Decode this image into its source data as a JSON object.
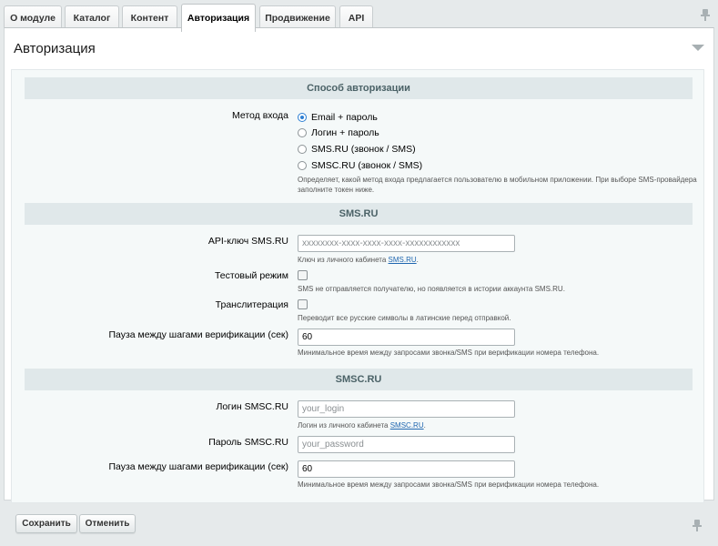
{
  "tabs": [
    {
      "label": "О модуле",
      "active": false
    },
    {
      "label": "Каталог",
      "active": false
    },
    {
      "label": "Контент",
      "active": false
    },
    {
      "label": "Авторизация",
      "active": true
    },
    {
      "label": "Продвижение",
      "active": false
    },
    {
      "label": "API",
      "active": false
    }
  ],
  "panel": {
    "title": "Авторизация"
  },
  "auth_section": {
    "title": "Способ авторизации",
    "method_label": "Метод входа",
    "options": [
      {
        "label": "Email + пароль",
        "checked": true
      },
      {
        "label": "Логин + пароль",
        "checked": false
      },
      {
        "label": "SMS.RU (звонок / SMS)",
        "checked": false
      },
      {
        "label": "SMSC.RU (звонок / SMS)",
        "checked": false
      }
    ],
    "hint_line1": "Определяет, какой метод входа предлагается пользователю в мобильном приложении. При выборе SMS-провайдера",
    "hint_line2": "заполните токен ниже."
  },
  "smsru_section": {
    "title": "SMS.RU",
    "api_key_label": "API-ключ SMS.RU",
    "api_key_placeholder": "xxxxxxxx-xxxx-xxxx-xxxx-xxxxxxxxxxxx",
    "api_key_hint_prefix": "Ключ из личного кабинета ",
    "api_key_hint_link": "SMS.RU",
    "api_key_hint_suffix": ".",
    "test_mode_label": "Тестовый режим",
    "test_mode_hint": "SMS не отправляется получателю, но появляется в истории аккаунта SMS.RU.",
    "translit_label": "Транслитерация",
    "translit_hint": "Переводит все русские символы в латинские перед отправкой.",
    "pause_label": "Пауза между шагами верификации (сек)",
    "pause_value": "60",
    "pause_hint": "Минимальное время между запросами звонка/SMS при верификации номера телефона."
  },
  "smscru_section": {
    "title": "SMSC.RU",
    "login_label": "Логин SMSC.RU",
    "login_placeholder": "your_login",
    "login_hint_prefix": "Логин из личного кабинета ",
    "login_hint_link": "SMSC.RU",
    "login_hint_suffix": ".",
    "password_label": "Пароль SMSC.RU",
    "password_placeholder": "your_password",
    "pause_label": "Пауза между шагами верификации (сек)",
    "pause_value": "60",
    "pause_hint": "Минимальное время между запросами звонка/SMS при верификации номера телефона."
  },
  "footer": {
    "save_label": "Сохранить",
    "cancel_label": "Отменить"
  },
  "icons": {
    "pin": "pin-icon",
    "collapse": "chevron-down-icon"
  },
  "colors": {
    "accent": "#2d7fd3",
    "section_bg": "#e0e8ea",
    "section_text": "#4b6267",
    "link": "#2067b0"
  }
}
